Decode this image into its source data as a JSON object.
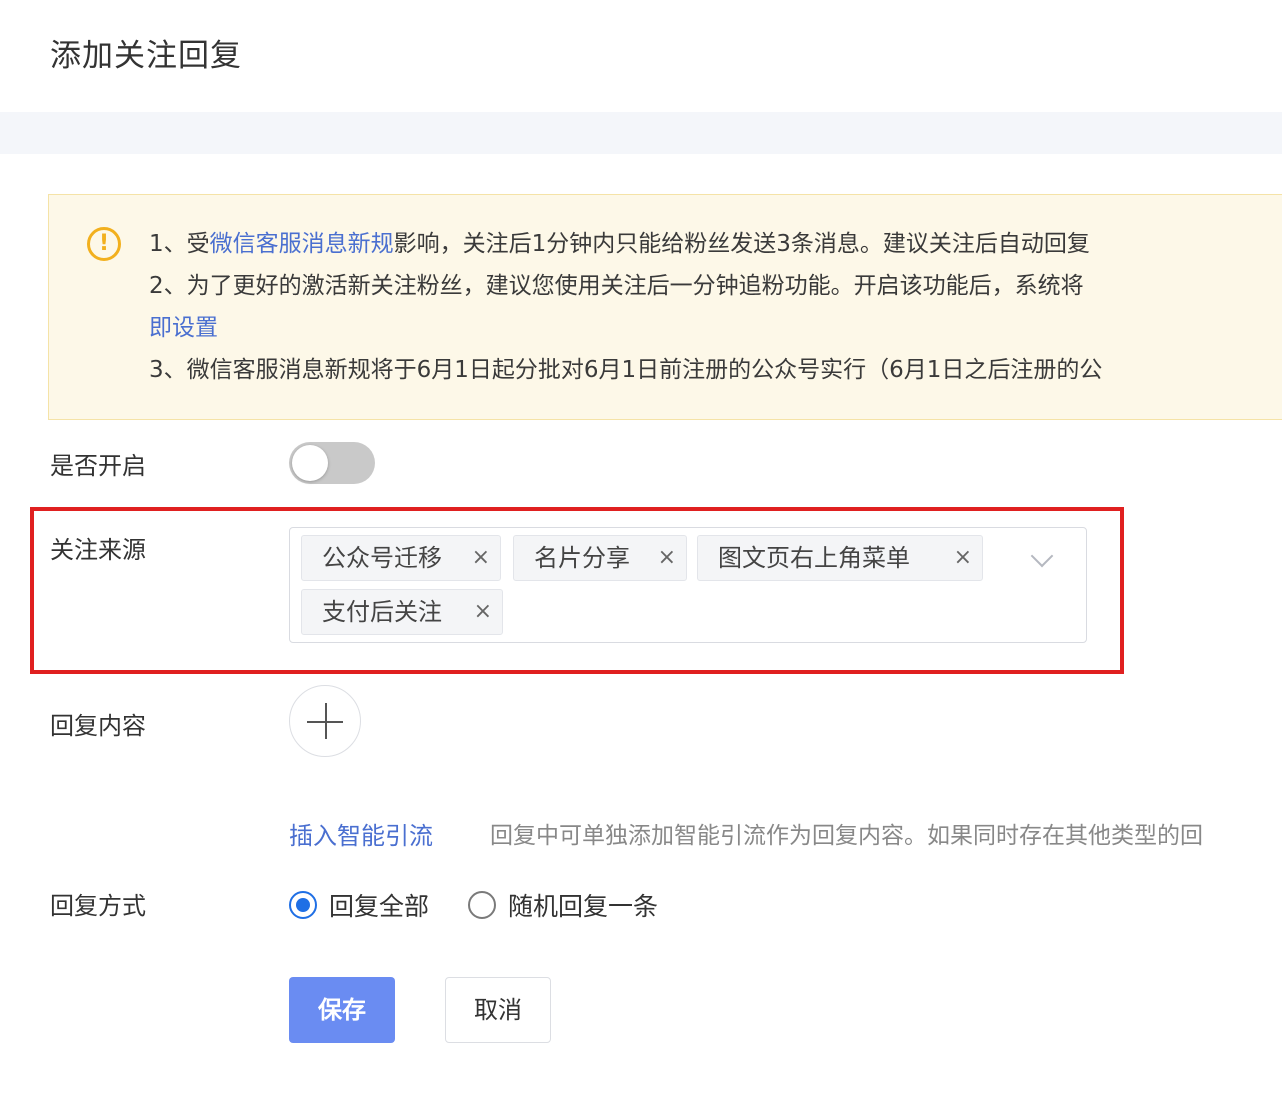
{
  "page": {
    "title": "添加关注回复"
  },
  "notice": {
    "icon": "warning-icon",
    "line1_prefix": "1、受",
    "line1_link": "微信客服消息新规",
    "line1_suffix": "影响，关注后1分钟内只能给粉丝发送3条消息。建议关注后自动回复",
    "line2": "2、为了更好的激活新关注粉丝，建议您使用关注后一分钟追粉功能。开启该功能后，系统将",
    "line2_link": "即设置",
    "line3": "3、微信客服消息新规将于6月1日起分批对6月1日前注册的公众号实行（6月1日之后注册的公"
  },
  "form": {
    "enable_label": "是否开启",
    "enable_on": false,
    "source_label": "关注来源",
    "source_tags": [
      "公众号迁移",
      "名片分享",
      "图文页右上角菜单",
      "支付后关注"
    ],
    "tag_close_glyph": "×",
    "content_label": "回复内容",
    "insert_link": "插入智能引流",
    "insert_hint": "回复中可单独添加智能引流作为回复内容。如果同时存在其他类型的回",
    "mode_label": "回复方式",
    "mode_options": [
      "回复全部",
      "随机回复一条"
    ],
    "mode_selected": "回复全部"
  },
  "buttons": {
    "save": "保存",
    "cancel": "取消"
  },
  "colors": {
    "primary": "#6a8cf2",
    "link": "#4a6fd0",
    "highlight": "#e02020",
    "warning": "#f2b01e",
    "radio_active": "#1f6fe5"
  }
}
